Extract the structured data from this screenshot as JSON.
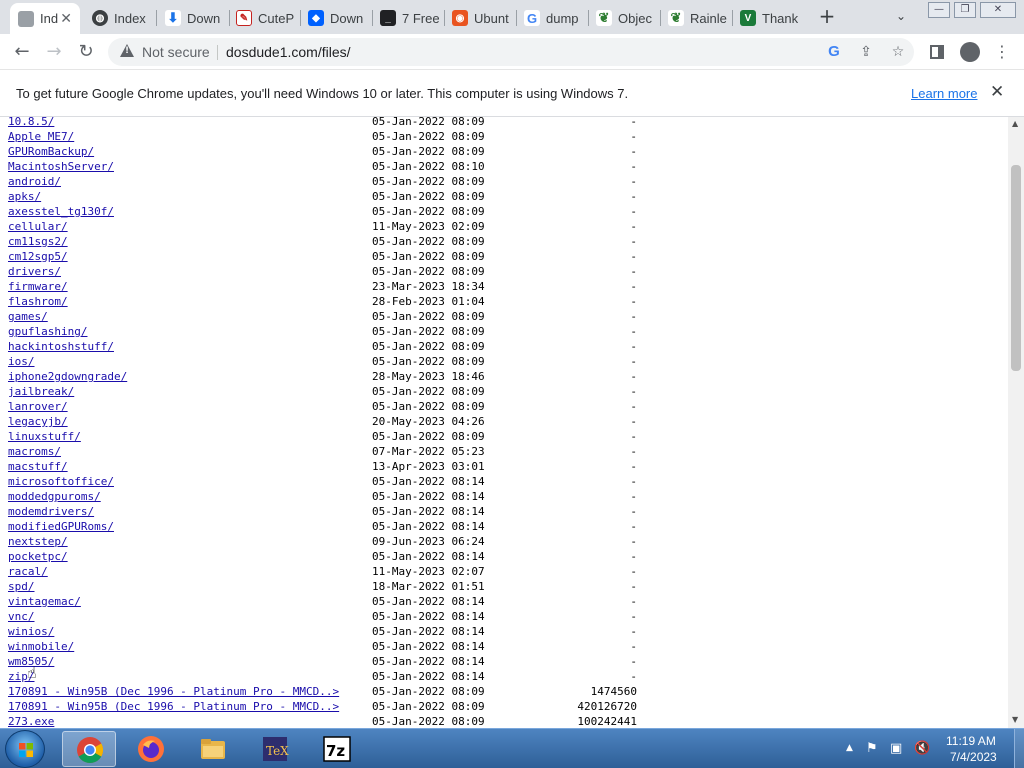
{
  "browser": {
    "tabs": [
      {
        "label": "Ind",
        "icon": "page-icon",
        "active": true
      },
      {
        "label": "Index",
        "icon": "globe-icon",
        "active": false
      },
      {
        "label": "Down",
        "icon": "download-icon",
        "active": false
      },
      {
        "label": "CuteP",
        "icon": "cutepdf-icon",
        "active": false
      },
      {
        "label": "Down",
        "icon": "dropbox-icon",
        "active": false
      },
      {
        "label": "7 Free",
        "icon": "terminal-icon",
        "active": false
      },
      {
        "label": "Ubunt",
        "icon": "ubuntu-icon",
        "active": false
      },
      {
        "label": "dump",
        "icon": "google-icon",
        "active": false
      },
      {
        "label": "Objec",
        "icon": "leaf-icon",
        "active": false
      },
      {
        "label": "Rainle",
        "icon": "leaf-icon",
        "active": false
      },
      {
        "label": "Thank",
        "icon": "v-icon",
        "active": false
      }
    ],
    "security_label": "Not secure",
    "url": "dosdude1.com/files/",
    "infobar": {
      "message": "To get future Google Chrome updates, you'll need Windows 10 or later. This computer is using Windows 7.",
      "link": "Learn more"
    }
  },
  "listing": [
    {
      "name": "10.8.5/",
      "date": "05-Jan-2022 08:09",
      "size": "-"
    },
    {
      "name": "Apple ME7/",
      "date": "05-Jan-2022 08:09",
      "size": "-"
    },
    {
      "name": "GPURomBackup/",
      "date": "05-Jan-2022 08:09",
      "size": "-"
    },
    {
      "name": "MacintoshServer/",
      "date": "05-Jan-2022 08:10",
      "size": "-"
    },
    {
      "name": "android/",
      "date": "05-Jan-2022 08:09",
      "size": "-"
    },
    {
      "name": "apks/",
      "date": "05-Jan-2022 08:09",
      "size": "-"
    },
    {
      "name": "axesstel_tg130f/",
      "date": "05-Jan-2022 08:09",
      "size": "-"
    },
    {
      "name": "cellular/",
      "date": "11-May-2023 02:09",
      "size": "-"
    },
    {
      "name": "cm11sgs2/",
      "date": "05-Jan-2022 08:09",
      "size": "-"
    },
    {
      "name": "cm12sgp5/",
      "date": "05-Jan-2022 08:09",
      "size": "-"
    },
    {
      "name": "drivers/",
      "date": "05-Jan-2022 08:09",
      "size": "-"
    },
    {
      "name": "firmware/",
      "date": "23-Mar-2023 18:34",
      "size": "-"
    },
    {
      "name": "flashrom/",
      "date": "28-Feb-2023 01:04",
      "size": "-"
    },
    {
      "name": "games/",
      "date": "05-Jan-2022 08:09",
      "size": "-"
    },
    {
      "name": "gpuflashing/",
      "date": "05-Jan-2022 08:09",
      "size": "-"
    },
    {
      "name": "hackintoshstuff/",
      "date": "05-Jan-2022 08:09",
      "size": "-"
    },
    {
      "name": "ios/",
      "date": "05-Jan-2022 08:09",
      "size": "-"
    },
    {
      "name": "iphone2gdowngrade/",
      "date": "28-May-2023 18:46",
      "size": "-"
    },
    {
      "name": "jailbreak/",
      "date": "05-Jan-2022 08:09",
      "size": "-"
    },
    {
      "name": "lanrover/",
      "date": "05-Jan-2022 08:09",
      "size": "-"
    },
    {
      "name": "legacyjb/",
      "date": "20-May-2023 04:26",
      "size": "-"
    },
    {
      "name": "linuxstuff/",
      "date": "05-Jan-2022 08:09",
      "size": "-"
    },
    {
      "name": "macroms/",
      "date": "07-Mar-2022 05:23",
      "size": "-"
    },
    {
      "name": "macstuff/",
      "date": "13-Apr-2023 03:01",
      "size": "-"
    },
    {
      "name": "microsoftoffice/",
      "date": "05-Jan-2022 08:14",
      "size": "-"
    },
    {
      "name": "moddedgpuroms/",
      "date": "05-Jan-2022 08:14",
      "size": "-"
    },
    {
      "name": "modemdrivers/",
      "date": "05-Jan-2022 08:14",
      "size": "-"
    },
    {
      "name": "modifiedGPURoms/",
      "date": "05-Jan-2022 08:14",
      "size": "-"
    },
    {
      "name": "nextstep/",
      "date": "09-Jun-2023 06:24",
      "size": "-"
    },
    {
      "name": "pocketpc/",
      "date": "05-Jan-2022 08:14",
      "size": "-"
    },
    {
      "name": "racal/",
      "date": "11-May-2023 02:07",
      "size": "-"
    },
    {
      "name": "spd/",
      "date": "18-Mar-2022 01:51",
      "size": "-"
    },
    {
      "name": "vintagemac/",
      "date": "05-Jan-2022 08:14",
      "size": "-"
    },
    {
      "name": "vnc/",
      "date": "05-Jan-2022 08:14",
      "size": "-"
    },
    {
      "name": "winios/",
      "date": "05-Jan-2022 08:14",
      "size": "-"
    },
    {
      "name": "winmobile/",
      "date": "05-Jan-2022 08:14",
      "size": "-"
    },
    {
      "name": "wm8505/",
      "date": "05-Jan-2022 08:14",
      "size": "-"
    },
    {
      "name": "zip/",
      "date": "05-Jan-2022 08:14",
      "size": "-"
    },
    {
      "name": "170891 - Win95B (Dec 1996 - Platinum Pro - MMCD..>",
      "date": "05-Jan-2022 08:09",
      "size": "1474560"
    },
    {
      "name": "170891 - Win95B (Dec 1996 - Platinum Pro - MMCD..>",
      "date": "05-Jan-2022 08:09",
      "size": "420126720"
    },
    {
      "name": "273.exe",
      "date": "05-Jan-2022 08:09",
      "size": "100242441"
    }
  ],
  "taskbar": {
    "apps": [
      "chrome",
      "firefox",
      "file-explorer",
      "texmaker",
      "7zip"
    ],
    "clock": {
      "time": "11:19 AM",
      "date": "7/4/2023"
    }
  },
  "colors": {
    "link": "#1a0dab",
    "tab_strip": "#dee1e6",
    "taskbar": "#3a6ea8"
  }
}
